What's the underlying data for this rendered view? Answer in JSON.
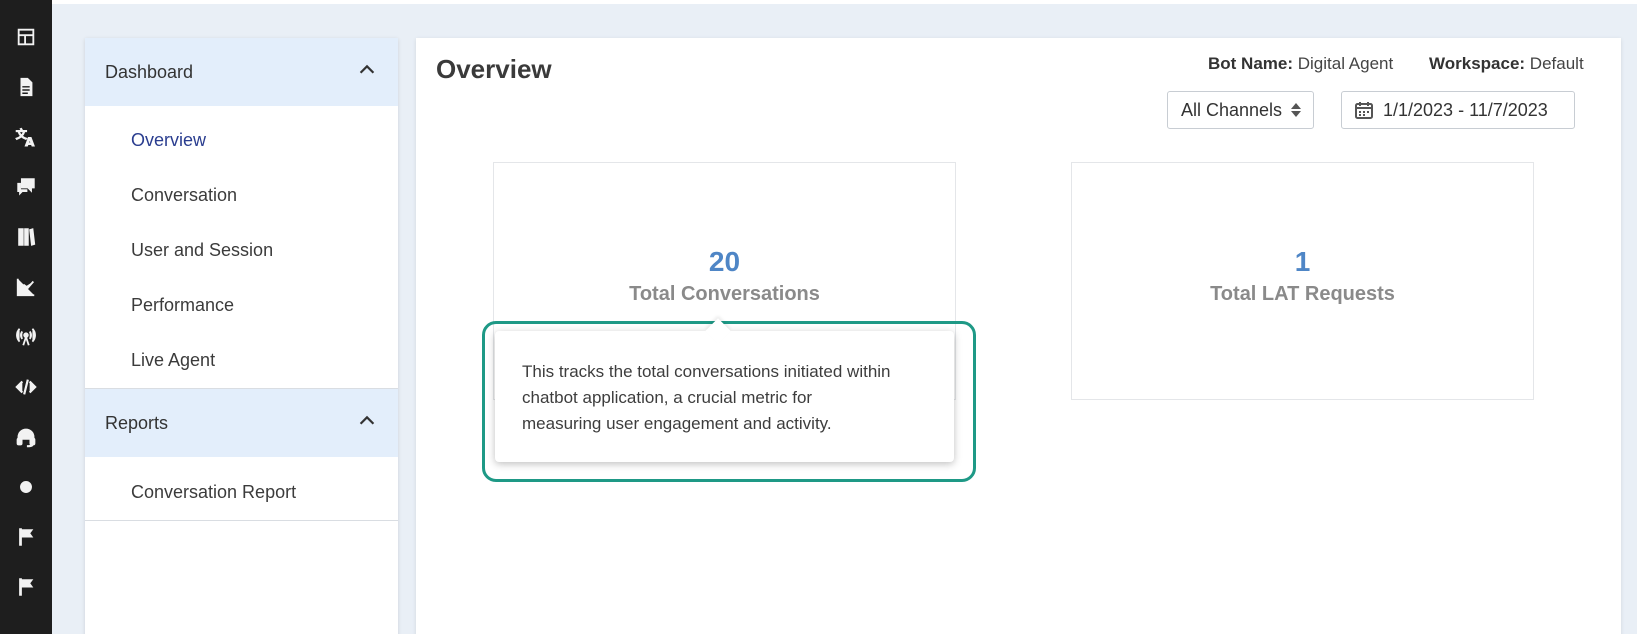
{
  "rail": {
    "icons": [
      "layout-icon",
      "document-icon",
      "translate-icon",
      "chat-icon",
      "library-icon",
      "analytics-icon",
      "broadcast-icon",
      "code-icon",
      "headset-icon",
      "dot-icon",
      "flag-icon",
      "flag-icon"
    ]
  },
  "sidebar": {
    "dashboard": {
      "label": "Dashboard",
      "items": [
        "Overview",
        "Conversation",
        "User and Session",
        "Performance",
        "Live Agent"
      ],
      "active": "Overview"
    },
    "reports": {
      "label": "Reports",
      "items": [
        "Conversation Report"
      ]
    }
  },
  "main": {
    "title": "Overview",
    "bot_name_label": "Bot Name:",
    "bot_name_value": "Digital Agent",
    "workspace_label": "Workspace:",
    "workspace_value": "Default",
    "channel_select": "All Channels",
    "date_range": "1/1/2023 - 11/7/2023",
    "cards": [
      {
        "value": "20",
        "label": "Total Conversations"
      },
      {
        "value": "1",
        "label": "Total LAT Requests"
      }
    ]
  },
  "tooltip": {
    "text_line1": "This tracks the total conversations initiated within",
    "text_line2": "chatbot application, a crucial metric for",
    "text_line3": "measuring user engagement and activity."
  },
  "colors": {
    "accent": "#4f86c6",
    "highlight": "#1e9986",
    "rail": "#1e1e1e",
    "section_header": "#e3eefb",
    "active_nav": "#2a3d8f"
  }
}
